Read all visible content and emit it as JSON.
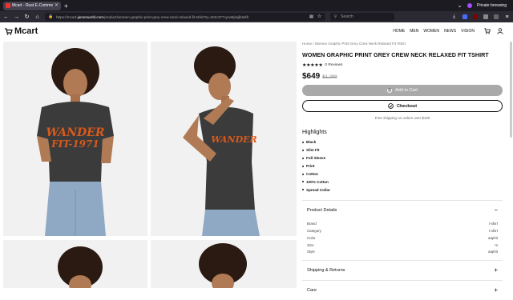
{
  "browser": {
    "tab_title": "Mcart - Rust E-Commerce Web",
    "url_prefix": "https://mcart.",
    "url_host": "jamerworld.com",
    "url_path": "/product/women-graphic-print-grey-crew-neck-relaxed-fit-tshirt?p=tS3c37?cyrwttjssjlbssfb",
    "search_placeholder": "Search",
    "private_label": "Private browsing"
  },
  "site": {
    "logo": "Mcart",
    "menu": [
      "HOME",
      "MEN",
      "WOMEN",
      "NEWS",
      "VISION"
    ]
  },
  "product": {
    "breadcrumb": "Home / Women Graphic Print Grey Crew Neck Relaxed Fit Tshirt",
    "title": "WOMEN GRAPHIC PRINT GREY CREW NECK RELAXED FIT TSHIRT",
    "stars": "★★★★★",
    "reviews": "0 Reviews",
    "price": "$649",
    "mrp": "$1,299",
    "add_to_cart": "Add to Cart",
    "checkout": "Checkout",
    "shipping_note": "Free shipping on orders over $100",
    "highlights_title": "Highlights",
    "highlights": [
      "Black",
      "Slim Fit",
      "Full Sleeve",
      "Print",
      "Cotton",
      "100% Cotton",
      "Spread Collar"
    ],
    "details_title": "Product Details",
    "specs": [
      {
        "label": "Brand",
        "value": "t-shirt"
      },
      {
        "label": "Category",
        "value": "t-shirt"
      },
      {
        "label": "Color",
        "value": "aaphit"
      },
      {
        "label": "Size",
        "value": "m"
      },
      {
        "label": "Style",
        "value": "aaphit"
      }
    ],
    "shipping_title": "Shipping & Returns",
    "care_title": "Care"
  },
  "colors": {
    "accent_dark": "#111111",
    "button_disabled": "#a9a9a9",
    "tshirt": "#3c3b3b",
    "print": "#d95a1b"
  }
}
